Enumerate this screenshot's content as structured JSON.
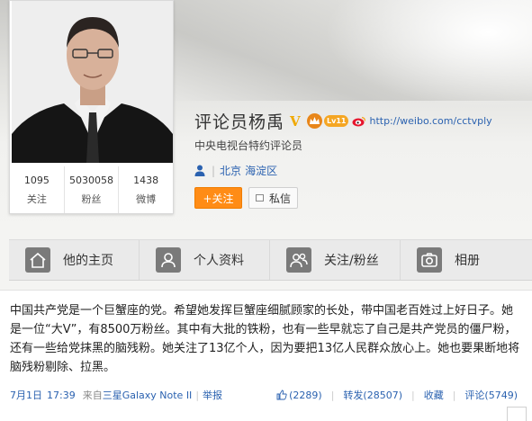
{
  "profile": {
    "name": "评论员杨禹",
    "verified_mark": "V",
    "level_badge": "Lv11",
    "url": "http://weibo.com/cctvply",
    "title": "中央电视台特约评论员",
    "location_city": "北京",
    "location_district": "海淀区"
  },
  "stats": [
    {
      "value": "1095",
      "label": "关注"
    },
    {
      "value": "5030058",
      "label": "粉丝"
    },
    {
      "value": "1438",
      "label": "微博"
    }
  ],
  "buttons": {
    "follow": "+关注",
    "message": "私信"
  },
  "tabs": [
    {
      "label": "他的主页",
      "icon": "home-icon"
    },
    {
      "label": "个人资料",
      "icon": "profile-icon"
    },
    {
      "label": "关注/粉丝",
      "icon": "follow-fans-icon"
    },
    {
      "label": "相册",
      "icon": "camera-icon"
    }
  ],
  "post": {
    "text": "中国共产党是一个巨蟹座的党。希望她发挥巨蟹座细腻顾家的长处，带中国老百姓过上好日子。她是一位“大V”，有8500万粉丝。其中有大批的铁粉，也有一些早就忘了自己是共产党员的僵尸粉，还有一些给党抹黑的脑残粉。她关注了13亿个人，因为要把13亿人民群众放心上。她也要果断地将脑残粉剔除、拉黑。",
    "date": "7月1日",
    "time": "17:39",
    "source_prefix": "来自",
    "source": "三星Galaxy Note II",
    "report": "举报",
    "like_count": "(2289)",
    "repost": "转发(28507)",
    "favorite": "收藏",
    "comment": "评论(5749)"
  },
  "colors": {
    "accent_blue": "#2b62b0",
    "follow_orange": "#ff8c16",
    "verified_gold": "#f0a900"
  }
}
